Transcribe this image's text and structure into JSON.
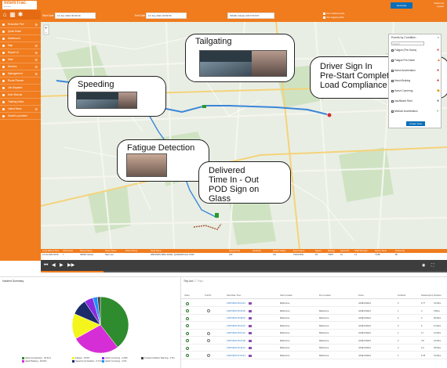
{
  "app": {
    "logo": "IntelliTrac",
    "logo_sub": "telematics",
    "user_line": "Welcome",
    "logout": "Logout"
  },
  "sidebar": {
    "icons": [
      "home-icon",
      "grid-icon",
      "settings-icon"
    ],
    "items": [
      {
        "label": "Executive Perf",
        "gear": "⚙"
      },
      {
        "label": "Quick Mode",
        "gear": ""
      },
      {
        "label": "Dashboard",
        "gear": ""
      },
      {
        "label": "Map",
        "gear": "⚙"
      },
      {
        "label": "Report v2",
        "gear": "⚙"
      },
      {
        "label": "Alert",
        "gear": "⚙"
      },
      {
        "label": "Devices",
        "gear": "⚙"
      },
      {
        "label": "Management",
        "gear": "⚙"
      },
      {
        "label": "Route Planner",
        "gear": ""
      },
      {
        "label": "Job Dispatch",
        "gear": ""
      },
      {
        "label": "User Manual",
        "gear": ""
      },
      {
        "label": "Training Video",
        "gear": ""
      },
      {
        "label": "Latest News",
        "gear": "⚙"
      },
      {
        "label": "Submit a problem",
        "gear": ""
      }
    ]
  },
  "toolbar": {
    "start_label": "Start Date",
    "start_value": "13 July 2022 00:00:00",
    "end_label": "End Date",
    "end_value": "13 July 2022 23:59:59",
    "vehicle_value": "INF001 Nissan 2017XXXXX",
    "opt1": "Use tracking data",
    "opt2": "Use logging data",
    "generate": "Generate"
  },
  "callouts": {
    "tailgating": "Tailgating",
    "speeding": "Speeding",
    "fatigue": "Fatigue Detection",
    "driver": [
      "Driver Sign In",
      "Pre-Start Completed",
      "Load Compliance"
    ],
    "delivered": [
      "Delivered",
      "Time In - Out",
      "POD Sign on Glass"
    ]
  },
  "events_panel": {
    "title": "Events by Condition :",
    "close": "×",
    "search_placeholder": "Search",
    "items": [
      {
        "label": "Fatigue (Pre-Hours)",
        "icon": "●",
        "color": "#e04040"
      },
      {
        "label": "Fatigue Pre-Harsh",
        "icon": "▲",
        "color": "#e08020"
      },
      {
        "label": "Harsh Acceleration",
        "icon": "●",
        "color": "#d03030"
      },
      {
        "label": "Harsh Braking",
        "icon": "●",
        "color": "#c02020"
      },
      {
        "label": "Harsh Cornering",
        "icon": "◆",
        "color": "#e0a020"
      },
      {
        "label": "Insufficient Rest",
        "icon": "●",
        "color": "#707070"
      },
      {
        "label": "Medium Acceleration",
        "icon": "◐",
        "color": "#40a040"
      }
    ],
    "create_view": "Create View"
  },
  "event_table": {
    "headers": [
      "Local Date & Time",
      "GPS Active",
      "Device Name",
      "Driver Name",
      "Driver Phone",
      "Road Name",
      "Speed Limit",
      "Geofence",
      "Ignition Status",
      "Event Name",
      "Speed",
      "Mileage",
      "Speed No",
      "GSM Strength",
      "Device Temp",
      "Device No"
    ],
    "row": [
      "13 Jul 2022 03:25",
      "Y",
      "INF001 Nissan",
      "Naor Lee",
      "",
      "WESTERN RING ROAD, QUAKERS HILL NSW",
      "100",
      "",
      "ON",
      "TRACKING",
      "93",
      "79457",
      "12",
      "13",
      "73.88",
      "86"
    ]
  },
  "player": {
    "controls": [
      "⏮",
      "◀",
      "▶",
      "▶▶"
    ]
  },
  "incident": {
    "title": "Incident Summary",
    "legend": [
      {
        "label": "Harsh Acceleration - 30.31%",
        "color": "#2e8b2e"
      },
      {
        "label": "Harsh Braking - 18.04%",
        "color": "#d62ed6"
      },
      {
        "label": "Fatigue - 18.9%",
        "color": "#f5f51e"
      },
      {
        "label": "Speed Limit Violation - 9.71%",
        "color": "#1a2a6a"
      },
      {
        "label": "Harsh Cornering - 4.29%",
        "color": "#8a2be2"
      },
      {
        "label": "Harsh Cornering - 3.2%",
        "color": "#1e90ff"
      },
      {
        "label": "Forward Collision Warning - 4.3%",
        "color": "#444444"
      }
    ]
  },
  "chart_data": {
    "type": "pie",
    "values": [
      39.5,
      27.4,
      14.6,
      9.1,
      5.1,
      2.6,
      1.7
    ],
    "colors": [
      "#2e8b2e",
      "#d62ed6",
      "#f5f51e",
      "#1a2a6a",
      "#8a2be2",
      "#1e90ff",
      "#444444"
    ]
  },
  "trips": {
    "title": "Trip List",
    "count": "17 Trips",
    "headers": [
      "Video",
      "Trail ID",
      "Start Date Time",
      "Start Location",
      "Fire Location",
      "Driver",
      "Incidents",
      "Distance(km)",
      "Duration"
    ],
    "rows": [
      {
        "time": "13/07/2022 05:24:44",
        "start": "Melbourne",
        "fire": "",
        "driver": "JANE DOE13",
        "inc": "3",
        "dist": "2.77",
        "dur": "31 Mins",
        "trail": false
      },
      {
        "time": "13/07/2022 05:32:36",
        "start": "Melbourne",
        "fire": "Melbourne",
        "driver": "JANE DOE13",
        "inc": "1",
        "dist": "3",
        "dur": "6 Mins",
        "trail": true
      },
      {
        "time": "13/07/2022 05:38:40",
        "start": "Melbourne",
        "fire": "Melbourne",
        "driver": "JANE DOE13",
        "inc": "2",
        "dist": "4",
        "dur": "35 Mins",
        "trail": false
      },
      {
        "time": "13/07/2022 05:44:16",
        "start": "Melbourne",
        "fire": "Melbourne",
        "driver": "JANE DOE13",
        "inc": "0",
        "dist": "6",
        "dur": "12 Mins",
        "trail": false
      },
      {
        "time": "13/07/2022 06:01:32",
        "start": "Melbourne",
        "fire": "Melbourne",
        "driver": "JANE DOE13",
        "inc": "1",
        "dist": "17",
        "dur": "21 Mins",
        "trail": true
      },
      {
        "time": "13/07/2022 06:21:08",
        "start": "Melbourne",
        "fire": "Melbourne",
        "driver": "JANE DOE13",
        "inc": "3",
        "dist": "4.8",
        "dur": "31 Mins",
        "trail": true
      },
      {
        "time": "13/07/2022 06:44:01",
        "start": "Melbourne",
        "fire": "Melbourne",
        "driver": "JANE DOE13",
        "inc": "4",
        "dist": "9.4",
        "dur": "35 Mins",
        "trail": false
      },
      {
        "time": "13/07/2022 07:02:44",
        "start": "Melbourne",
        "fire": "Melbourne",
        "driver": "JANE DOE13",
        "inc": "1",
        "dist": "5.78",
        "dur": "31 Mins",
        "trail": true
      }
    ]
  }
}
